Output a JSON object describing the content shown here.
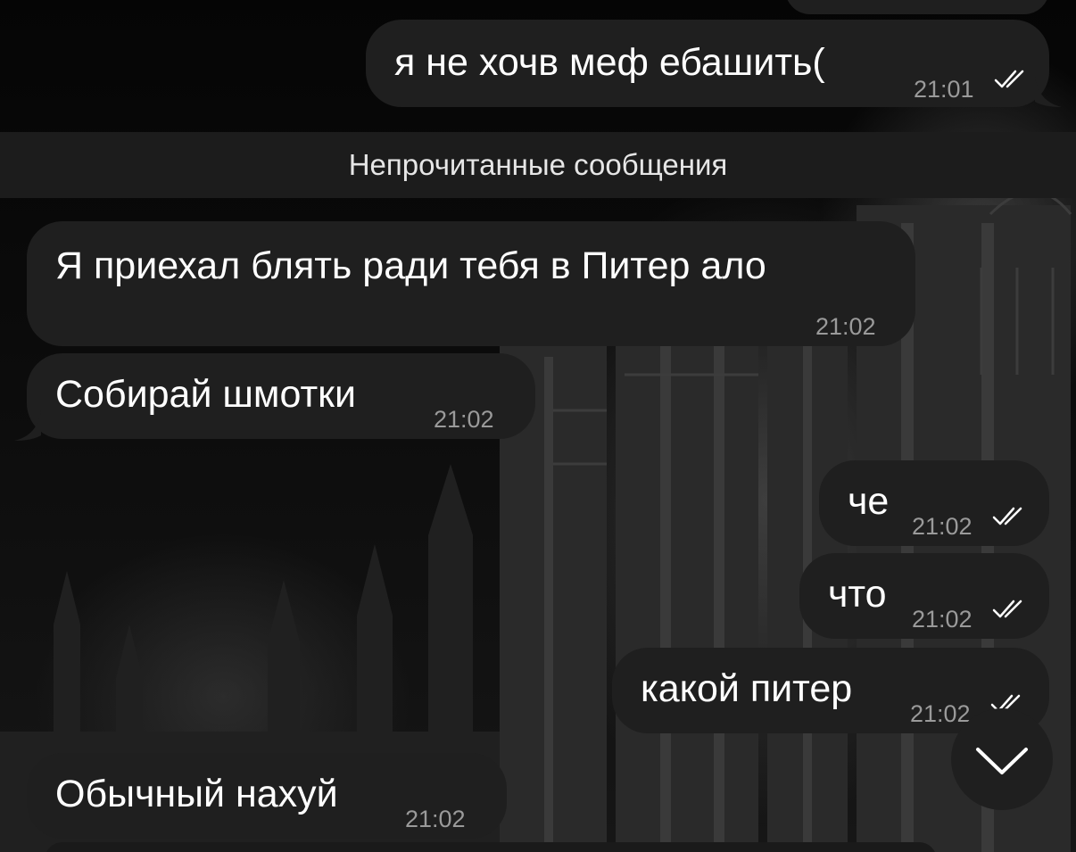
{
  "divider": {
    "label": "Непрочитанные сообщения"
  },
  "messages": [
    {
      "text": "я не хочв меф ебашить(",
      "time": "21:01",
      "direction": "outgoing",
      "status": "read"
    },
    {
      "text": "Я приехал блять ради тебя в Питер ало",
      "time": "21:02",
      "direction": "incoming"
    },
    {
      "text": "Собирай шмотки",
      "time": "21:02",
      "direction": "incoming"
    },
    {
      "text": "че",
      "time": "21:02",
      "direction": "outgoing",
      "status": "read"
    },
    {
      "text": "что",
      "time": "21:02",
      "direction": "outgoing",
      "status": "read"
    },
    {
      "text": "какой питер",
      "time": "21:02",
      "direction": "outgoing",
      "status": "read"
    },
    {
      "text": "Обычный нахуй",
      "time": "21:02",
      "direction": "incoming"
    }
  ],
  "scroll_button": {
    "icon": "chevron-down-icon"
  },
  "colors": {
    "bubble": "#1f1f1f",
    "time": "#9a9a9a",
    "divider": "#1c1c1c"
  }
}
